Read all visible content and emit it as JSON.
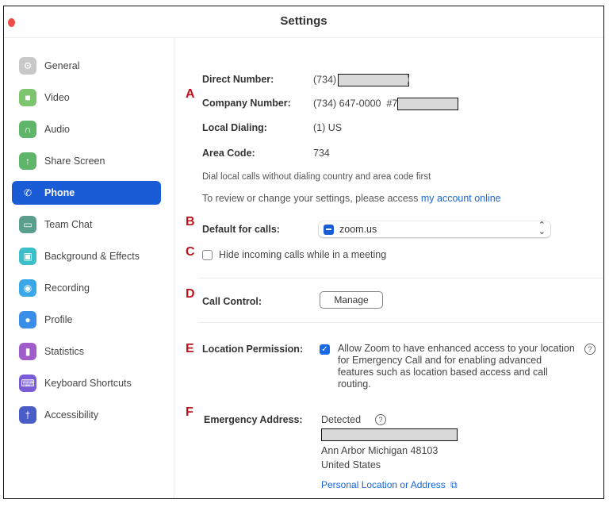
{
  "window": {
    "title": "Settings"
  },
  "sidebar": {
    "items": [
      {
        "label": "General",
        "icon": "gear-icon",
        "color": "#c8c8c8",
        "glyph": "⚙",
        "active": false
      },
      {
        "label": "Video",
        "icon": "video-camera-icon",
        "color": "#7cc46e",
        "glyph": "■",
        "active": false
      },
      {
        "label": "Audio",
        "icon": "headphones-icon",
        "color": "#5fb56a",
        "glyph": "∩",
        "active": false
      },
      {
        "label": "Share Screen",
        "icon": "share-screen-icon",
        "color": "#5fb56a",
        "glyph": "↑",
        "active": false
      },
      {
        "label": "Phone",
        "icon": "phone-icon",
        "color": "#1a5cd6",
        "glyph": "✆",
        "active": true
      },
      {
        "label": "Team Chat",
        "icon": "chat-icon",
        "color": "#5a9e8e",
        "glyph": "▭",
        "active": false
      },
      {
        "label": "Background & Effects",
        "icon": "background-icon",
        "color": "#3cbfc8",
        "glyph": "▣",
        "active": false
      },
      {
        "label": "Recording",
        "icon": "recording-icon",
        "color": "#3aa8e8",
        "glyph": "◉",
        "active": false
      },
      {
        "label": "Profile",
        "icon": "profile-icon",
        "color": "#3b8ee8",
        "glyph": "●",
        "active": false
      },
      {
        "label": "Statistics",
        "icon": "statistics-icon",
        "color": "#a05cc8",
        "glyph": "▮",
        "active": false
      },
      {
        "label": "Keyboard Shortcuts",
        "icon": "keyboard-icon",
        "color": "#7a5cd6",
        "glyph": "⌨",
        "active": false
      },
      {
        "label": "Accessibility",
        "icon": "accessibility-icon",
        "color": "#4a5cc8",
        "glyph": "†",
        "active": false
      }
    ]
  },
  "phone": {
    "markers": {
      "a": "A",
      "b": "B",
      "c": "C",
      "d": "D",
      "e": "E",
      "f": "F"
    },
    "direct_number": {
      "label": "Direct Number:",
      "value_prefix": "(734)",
      "value_suffix": ")"
    },
    "company_number": {
      "label": "Company Number:",
      "value_prefix": "(734) 647-0000  #7"
    },
    "local_dialing": {
      "label": "Local Dialing:",
      "value": "(1) US"
    },
    "area_code": {
      "label": "Area Code:",
      "value": "734"
    },
    "dial_note": "Dial local calls without dialing country and area code first",
    "review_note": "To review or change your settings, please access",
    "review_link": "my account online",
    "default_calls": {
      "label": "Default for calls:",
      "selected": "zoom.us"
    },
    "hide_incoming": {
      "label": "Hide incoming calls while in a meeting",
      "checked": false
    },
    "call_control": {
      "label": "Call Control:",
      "button": "Manage"
    },
    "location_permission": {
      "label": "Location Permission:",
      "checked": true,
      "text": "Allow Zoom to have enhanced access to your location for Emergency Call and for enabling advanced features such as location based access and call routing."
    },
    "emergency_address": {
      "label": "Emergency Address:",
      "status": "Detected",
      "city_line": "Ann Arbor Michigan 48103",
      "country_line": "United States",
      "link": "Personal Location or Address"
    },
    "help_glyph": "?",
    "check_glyph": "✓",
    "external_glyph": "⧉"
  }
}
